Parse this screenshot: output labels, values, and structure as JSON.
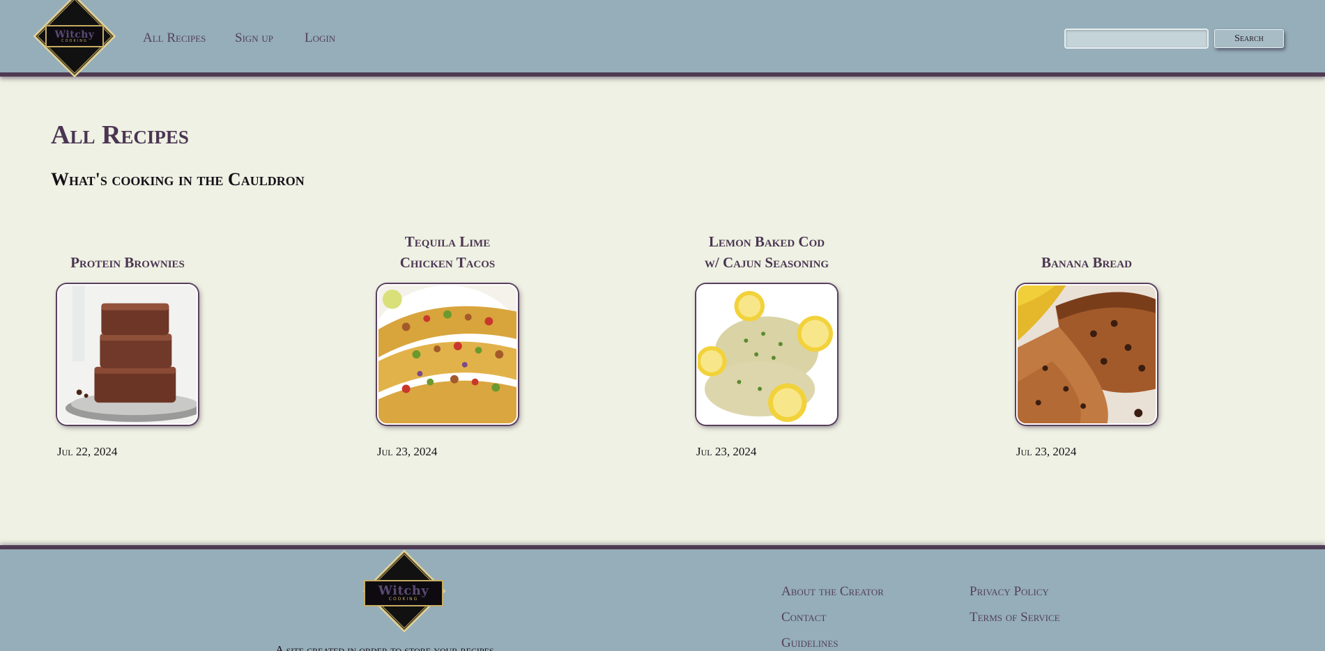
{
  "brand": {
    "logo_word": "Witchy",
    "logo_sub": "COOKING"
  },
  "nav": {
    "all_recipes": "All Recipes",
    "sign_up": "Sign up",
    "login": "Login"
  },
  "search": {
    "value": "",
    "placeholder": "",
    "button_label": "Search"
  },
  "main": {
    "title": "All Recipes",
    "subtitle": "What's cooking in the Cauldron"
  },
  "recipes": [
    {
      "title_line1": "",
      "title_line2": "Protein Brownies",
      "date": "Jul 22, 2024",
      "image_icon": "brownie-image"
    },
    {
      "title_line1": "Tequila Lime",
      "title_line2": "Chicken Tacos",
      "date": "Jul 23, 2024",
      "image_icon": "tacos-image"
    },
    {
      "title_line1": "Lemon Baked Cod",
      "title_line2": "w/ Cajun Seasoning",
      "date": "Jul 23, 2024",
      "image_icon": "cod-image"
    },
    {
      "title_line1": "",
      "title_line2": "Banana Bread",
      "date": "Jul 23, 2024",
      "image_icon": "banana-bread-image"
    }
  ],
  "footer": {
    "tagline": "A site created in order to store your recipes",
    "links": {
      "about": "About the Creator",
      "contact": "Contact",
      "guidelines": "Guidelines",
      "privacy": "Privacy Policy",
      "terms": "Terms of Service"
    }
  },
  "colors": {
    "header_bg": "#95aeb9",
    "page_bg": "#eef1e3",
    "accent_purple": "#4b3552",
    "logo_gold": "#c7ad63"
  }
}
